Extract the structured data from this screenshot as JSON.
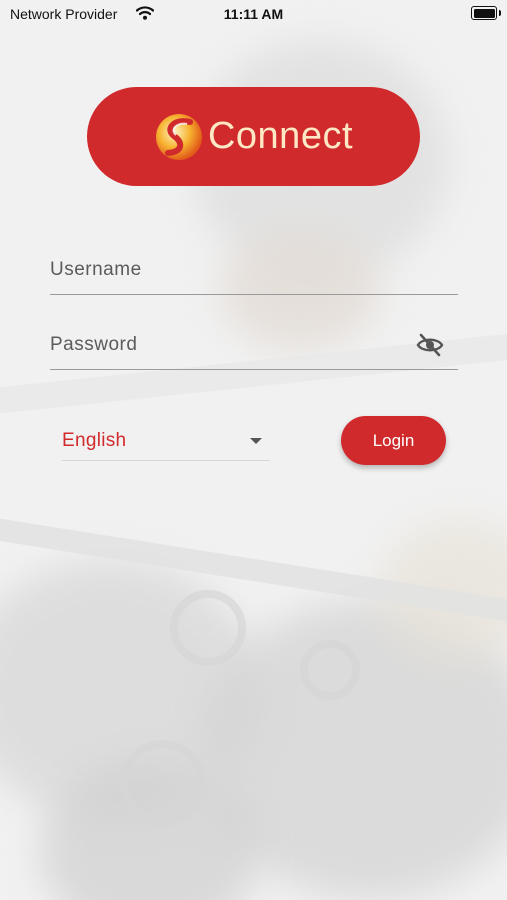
{
  "status_bar": {
    "carrier": "Network Provider",
    "time": "11:11 AM"
  },
  "logo": {
    "text": "Connect",
    "color": "#d12a2c"
  },
  "form": {
    "username_placeholder": "Username",
    "password_placeholder": "Password",
    "password_toggle_icon": "eye-off-icon",
    "language_value": "English",
    "login_label": "Login"
  },
  "colors": {
    "accent": "#d12a2c",
    "logo_text": "#fde7c5"
  }
}
